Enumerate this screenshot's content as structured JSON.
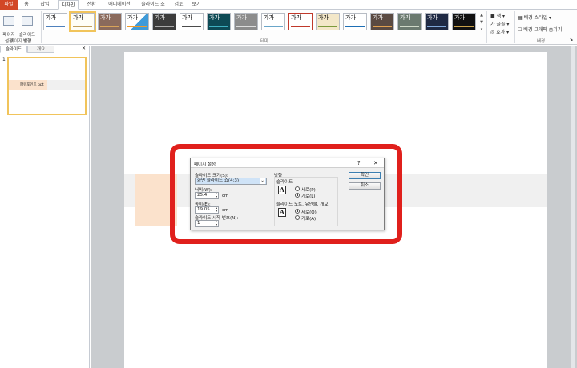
{
  "ribbon_tabs": [
    "파일",
    "홈",
    "삽입",
    "디자인",
    "전환",
    "애니메이션",
    "슬라이드 쇼",
    "검토",
    "보기"
  ],
  "ribbon": {
    "page_setup_label": "페이지\n설정",
    "orientation_label": "슬라이드\n방향",
    "group_page_setup": "페이지 설정",
    "group_theme": "테마",
    "group_background": "배경",
    "theme_sample": "가가",
    "color_label": "색",
    "font_label": "글꼴",
    "effects_label": "효과",
    "bg_style_label": "배경 스타일",
    "hide_bg_label": "배경 그래픽 숨기기"
  },
  "left_pane": {
    "tab_slides": "슬라이드",
    "tab_outline": "개요",
    "slide_number": "1",
    "thumb_text": "파워포인트 ppt"
  },
  "dialog": {
    "title": "페이지 설정",
    "help": "?",
    "close": "✕",
    "size_label": "슬라이드 크기(S):",
    "size_value": "화면 슬라이드 쇼(4:3)",
    "width_label": "너비(W):",
    "width_value": "25.4",
    "height_label": "높이(E):",
    "height_value": "19.05",
    "unit": "cm",
    "start_label": "슬라이드 시작 번호(N):",
    "start_value": "1",
    "orientation_title": "방향",
    "slide_group": "슬라이드",
    "portrait": "세로(P)",
    "landscape": "가로(L)",
    "notes_group": "슬라이드 노트, 유인물, 개요",
    "notes_portrait": "세로(O)",
    "notes_landscape": "가로(A)",
    "ok": "확인",
    "cancel": "취소"
  },
  "colors": {
    "file_tab": "#d24726",
    "accent_band": "#fbe2cc",
    "red_mark": "#e0201c"
  }
}
